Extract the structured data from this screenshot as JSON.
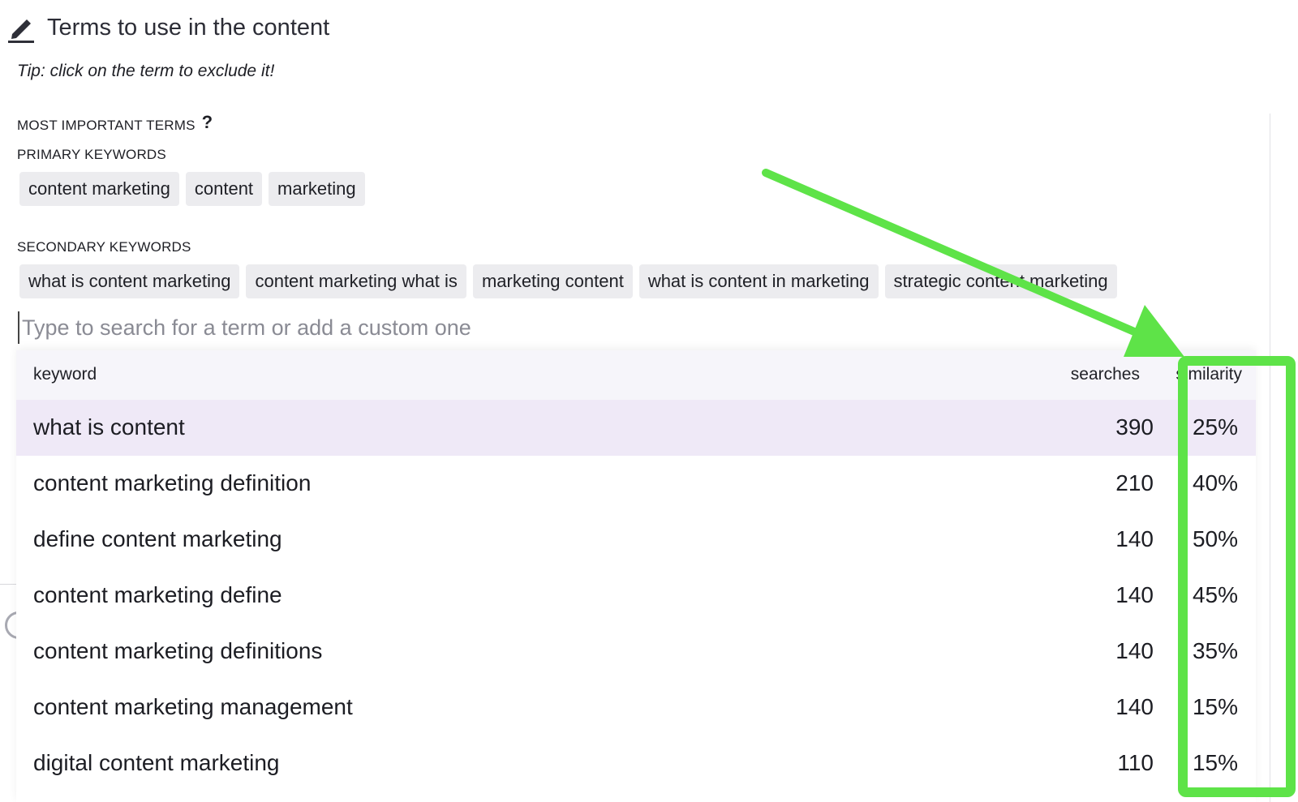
{
  "header": {
    "icon": "pencil-icon",
    "title": "Terms to use in the content"
  },
  "tip": "Tip: click on the term to exclude it!",
  "most_important": {
    "label": "MOST IMPORTANT TERMS",
    "help_symbol": "?"
  },
  "primary": {
    "label": "PRIMARY KEYWORDS",
    "chips": [
      "content marketing",
      "content",
      "marketing"
    ]
  },
  "secondary": {
    "label": "SECONDARY KEYWORDS",
    "chips": [
      "what is content marketing",
      "content marketing what is",
      "marketing content",
      "what is content in marketing",
      "strategic content marketing"
    ]
  },
  "search": {
    "placeholder": "Type to search for a term or add a custom one",
    "value": ""
  },
  "dropdown": {
    "columns": {
      "keyword": "keyword",
      "searches": "searches",
      "similarity": "similarity"
    },
    "rows": [
      {
        "keyword": "what is content",
        "searches": "390",
        "similarity": "25%"
      },
      {
        "keyword": "content marketing definition",
        "searches": "210",
        "similarity": "40%"
      },
      {
        "keyword": "define content marketing",
        "searches": "140",
        "similarity": "50%"
      },
      {
        "keyword": "content marketing define",
        "searches": "140",
        "similarity": "45%"
      },
      {
        "keyword": "content marketing definitions",
        "searches": "140",
        "similarity": "35%"
      },
      {
        "keyword": "content marketing management",
        "searches": "140",
        "similarity": "15%"
      },
      {
        "keyword": "digital content marketing",
        "searches": "110",
        "similarity": "15%"
      }
    ]
  },
  "colors": {
    "highlight_green": "#5ee348",
    "chip_bg": "#ececef",
    "active_row_bg": "#efe9f7",
    "header_bg": "#f6f5fa"
  }
}
